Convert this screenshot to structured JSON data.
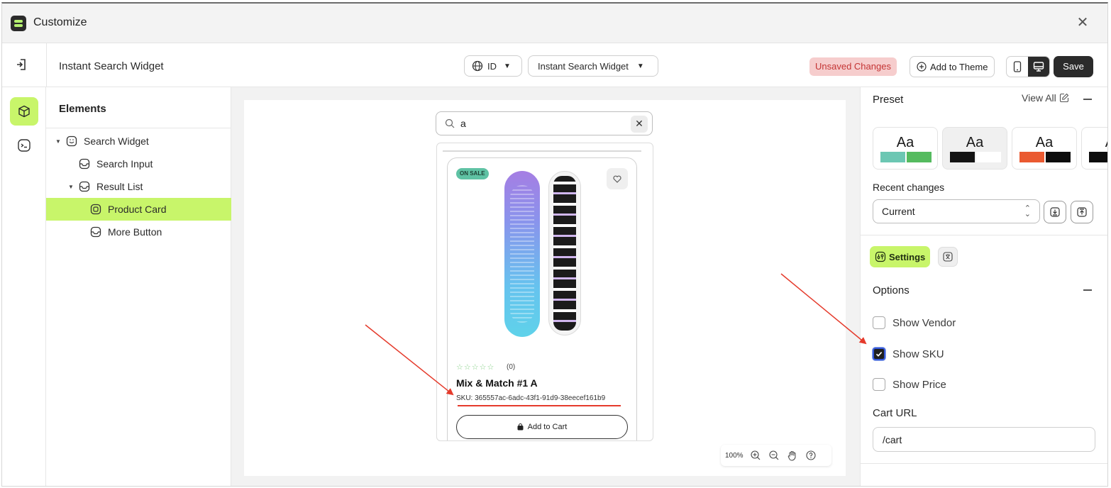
{
  "window": {
    "title": "Customize"
  },
  "toolbar": {
    "widget_title": "Instant Search Widget",
    "language": "ID",
    "widget_selector": "Instant Search Widget",
    "unsaved_label": "Unsaved Changes",
    "add_to_theme_label": "Add to Theme",
    "save_label": "Save",
    "active_device": "desktop"
  },
  "elements_panel": {
    "heading": "Elements",
    "items": [
      {
        "label": "Search Widget",
        "level": 0,
        "expanded": true
      },
      {
        "label": "Search Input",
        "level": 1
      },
      {
        "label": "Result List",
        "level": 1,
        "expanded": true
      },
      {
        "label": "Product Card",
        "level": 2,
        "selected": true
      },
      {
        "label": "More Button",
        "level": 2
      }
    ]
  },
  "preview": {
    "search_value": "a",
    "product": {
      "badge": "ON SALE",
      "stars": "☆☆☆☆☆",
      "rating_count": "(0)",
      "title": "Mix & Match #1 A",
      "sku": "SKU: 365557ac-6adc-43f1-91d9-38eecef161b9",
      "add_to_cart_label": "Add to Cart"
    },
    "zoom": "100%"
  },
  "right_panel": {
    "preset_label": "Preset",
    "view_all_label": "View All",
    "presets": [
      {
        "label": "Aa",
        "swatches": [
          "#6cc7b3",
          "#55bb5f"
        ]
      },
      {
        "label": "Aa",
        "swatches": [
          "#141414",
          "#ffffff"
        ],
        "selected": true
      },
      {
        "label": "Aa",
        "swatches": [
          "#ea5a31",
          "#0d0d0d"
        ]
      },
      {
        "label": "Aa",
        "swatches": [
          "#0d0d0d",
          "#0d0d0d"
        ]
      }
    ],
    "recent_changes_label": "Recent changes",
    "recent_changes_value": "Current",
    "settings_tab_label": "Settings",
    "options_label": "Options",
    "options": [
      {
        "label": "Show Vendor",
        "checked": false
      },
      {
        "label": "Show SKU",
        "checked": true
      },
      {
        "label": "Show Price",
        "checked": false
      }
    ],
    "cart_url_label": "Cart URL",
    "cart_url_value": "/cart"
  },
  "colors": {
    "accent": "#c8f56a",
    "dark": "#2b2b2b",
    "unsaved_bg": "#f6cdcd",
    "unsaved_text": "#c43434",
    "annotation": "#e53b2c"
  }
}
